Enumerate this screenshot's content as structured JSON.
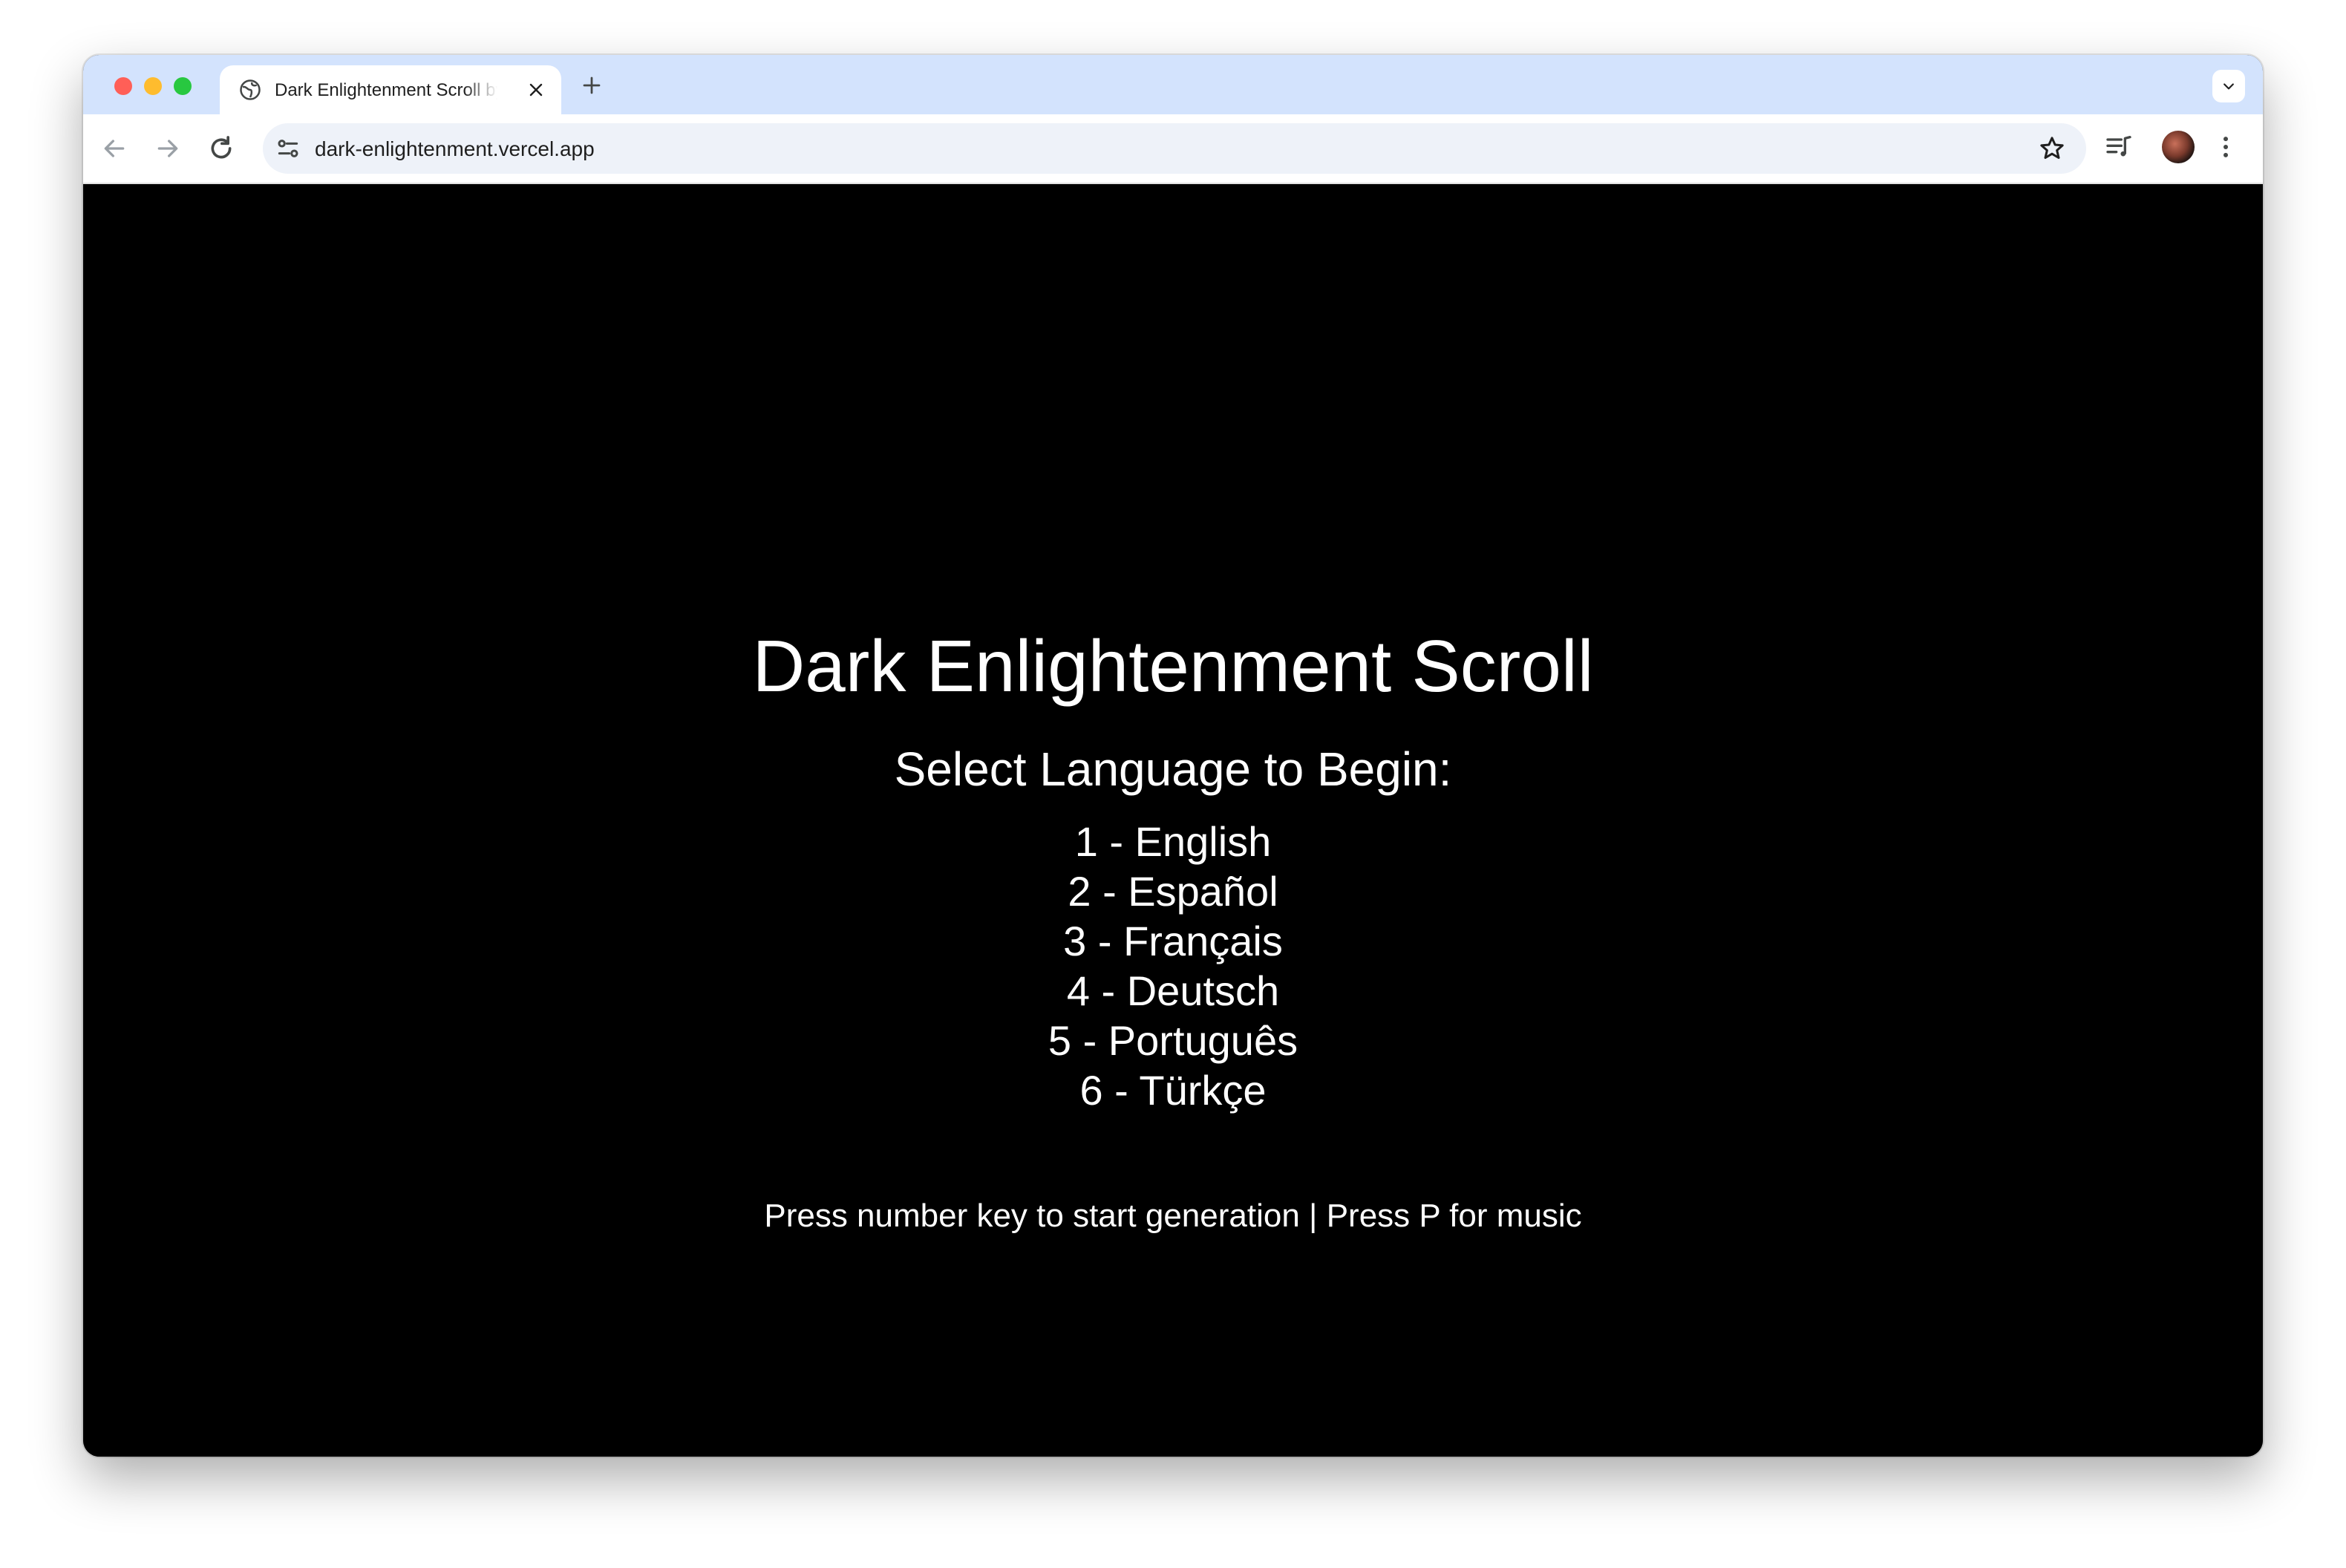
{
  "browser": {
    "tab": {
      "title": "Dark Enlightenment Scroll by",
      "favicon": "globe-icon"
    },
    "url": "dark-enlightenment.vercel.app"
  },
  "page": {
    "title": "Dark Enlightenment Scroll",
    "subtitle": "Select Language to Begin:",
    "languages": [
      "1 - English",
      "2 - Español",
      "3 - Français",
      "4 - Deutsch",
      "5 - Português",
      "6 - Türkçe"
    ],
    "hint": "Press number key to start generation | Press P for music"
  },
  "colors": {
    "page_background": "#000000",
    "page_text": "#ffffff",
    "tabstrip": "#d3e3fd"
  }
}
